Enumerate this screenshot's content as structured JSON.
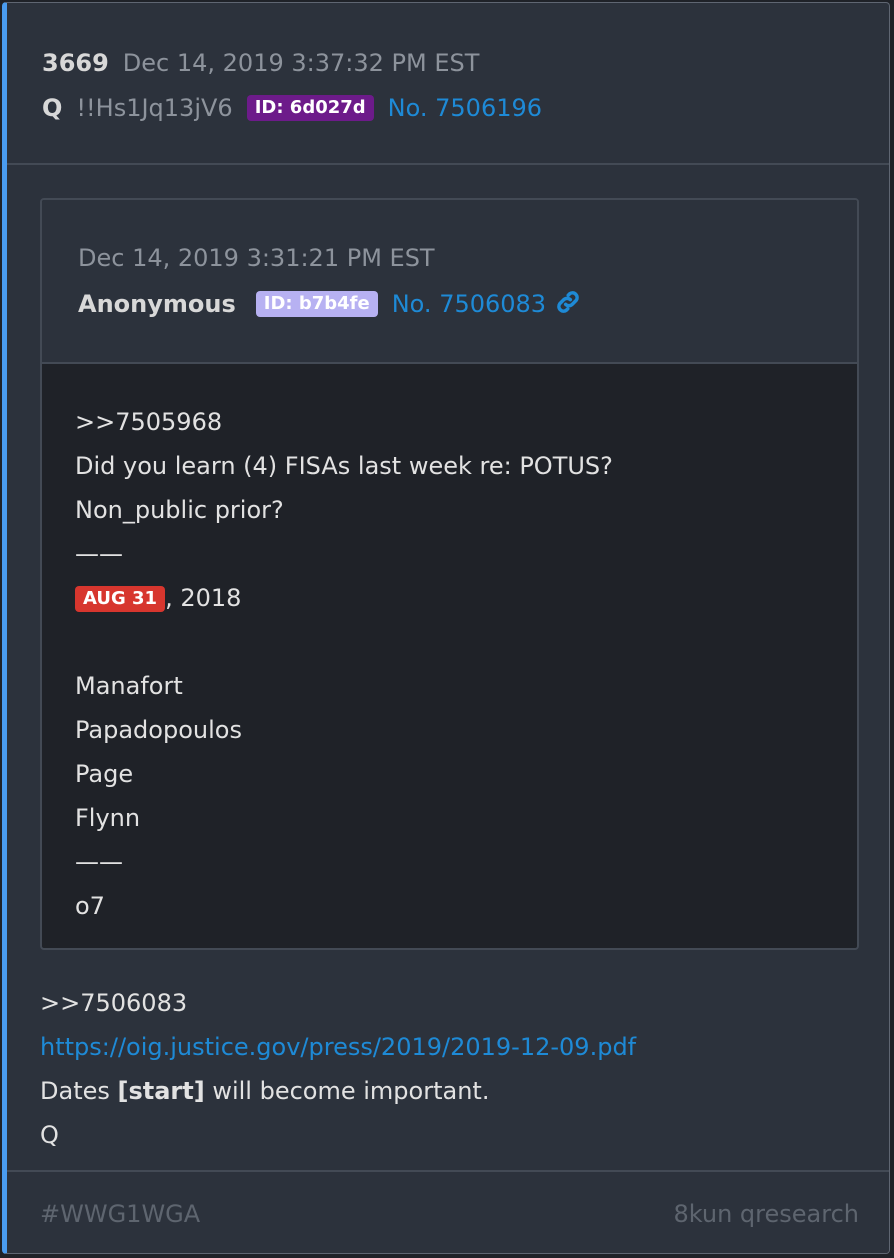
{
  "post": {
    "number": "3669",
    "datetime": "Dec 14, 2019 3:37:32 PM EST",
    "author": "Q",
    "tripcode": "!!Hs1Jq13jV6",
    "id_badge": "ID: 6d027d",
    "post_no": "No. 7506196",
    "id_color": "#6d1b8a"
  },
  "quoted": {
    "datetime": "Dec 14, 2019 3:31:21 PM EST",
    "author": "Anonymous",
    "id_badge": "ID: b7b4fe",
    "post_no": "No. 7506083",
    "link_icon": "link-icon",
    "lines": {
      "l1": ">>7505968",
      "l2": "Did you learn (4) FISAs last week re: POTUS?",
      "l3": "Non_public prior?",
      "l4": "——",
      "date_badge": "AUG 31",
      "date_suffix": ", 2018",
      "l6": "",
      "l7": "Manafort",
      "l8": "Papadopoulos",
      "l9": "Page",
      "l10": "Flynn",
      "l11": "——",
      "l12": "o7"
    }
  },
  "body": {
    "ref": ">>7506083",
    "url": "https://oig.justice.gov/press/2019/2019-12-09.pdf",
    "line3_prefix": "Dates ",
    "line3_bold": "[start]",
    "line3_suffix": " will become important.",
    "signature": "Q"
  },
  "footer": {
    "hashtag": "#WWG1WGA",
    "source": "8kun qresearch"
  },
  "colors": {
    "accent": "#4a9cf0",
    "link": "#1e8ad6",
    "date_badge": "#d7362e"
  }
}
